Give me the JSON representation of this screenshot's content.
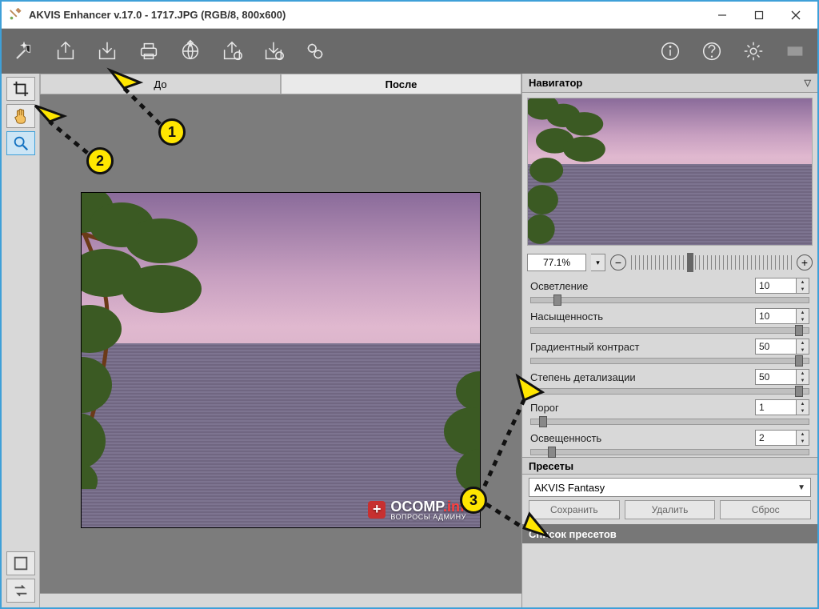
{
  "title": "AKVIS Enhancer v.17.0 - 1717.JPG (RGB/8, 800x600)",
  "tabs": {
    "before": "До",
    "after": "После"
  },
  "navigator": {
    "title": "Навигатор",
    "zoom": "77.1%"
  },
  "params": [
    {
      "label": "Осветление",
      "value": "10",
      "pos": 8
    },
    {
      "label": "Насыщенность",
      "value": "10",
      "pos": 95
    },
    {
      "label": "Градиентный контраст",
      "value": "50",
      "pos": 95
    },
    {
      "label": "Степень детализации",
      "value": "50",
      "pos": 95
    },
    {
      "label": "Порог",
      "value": "1",
      "pos": 3
    },
    {
      "label": "Освещенность",
      "value": "2",
      "pos": 6
    }
  ],
  "presets": {
    "title": "Пресеты",
    "selected": "AKVIS Fantasy",
    "save": "Сохранить",
    "delete": "Удалить",
    "reset": "Сброс",
    "list_title": "Список пресетов"
  },
  "watermark": {
    "main": "OCOMP",
    "tld": ".info",
    "sub": "ВОПРОСЫ АДМИНУ"
  },
  "annotations": {
    "b1": "1",
    "b2": "2",
    "b3": "3"
  }
}
